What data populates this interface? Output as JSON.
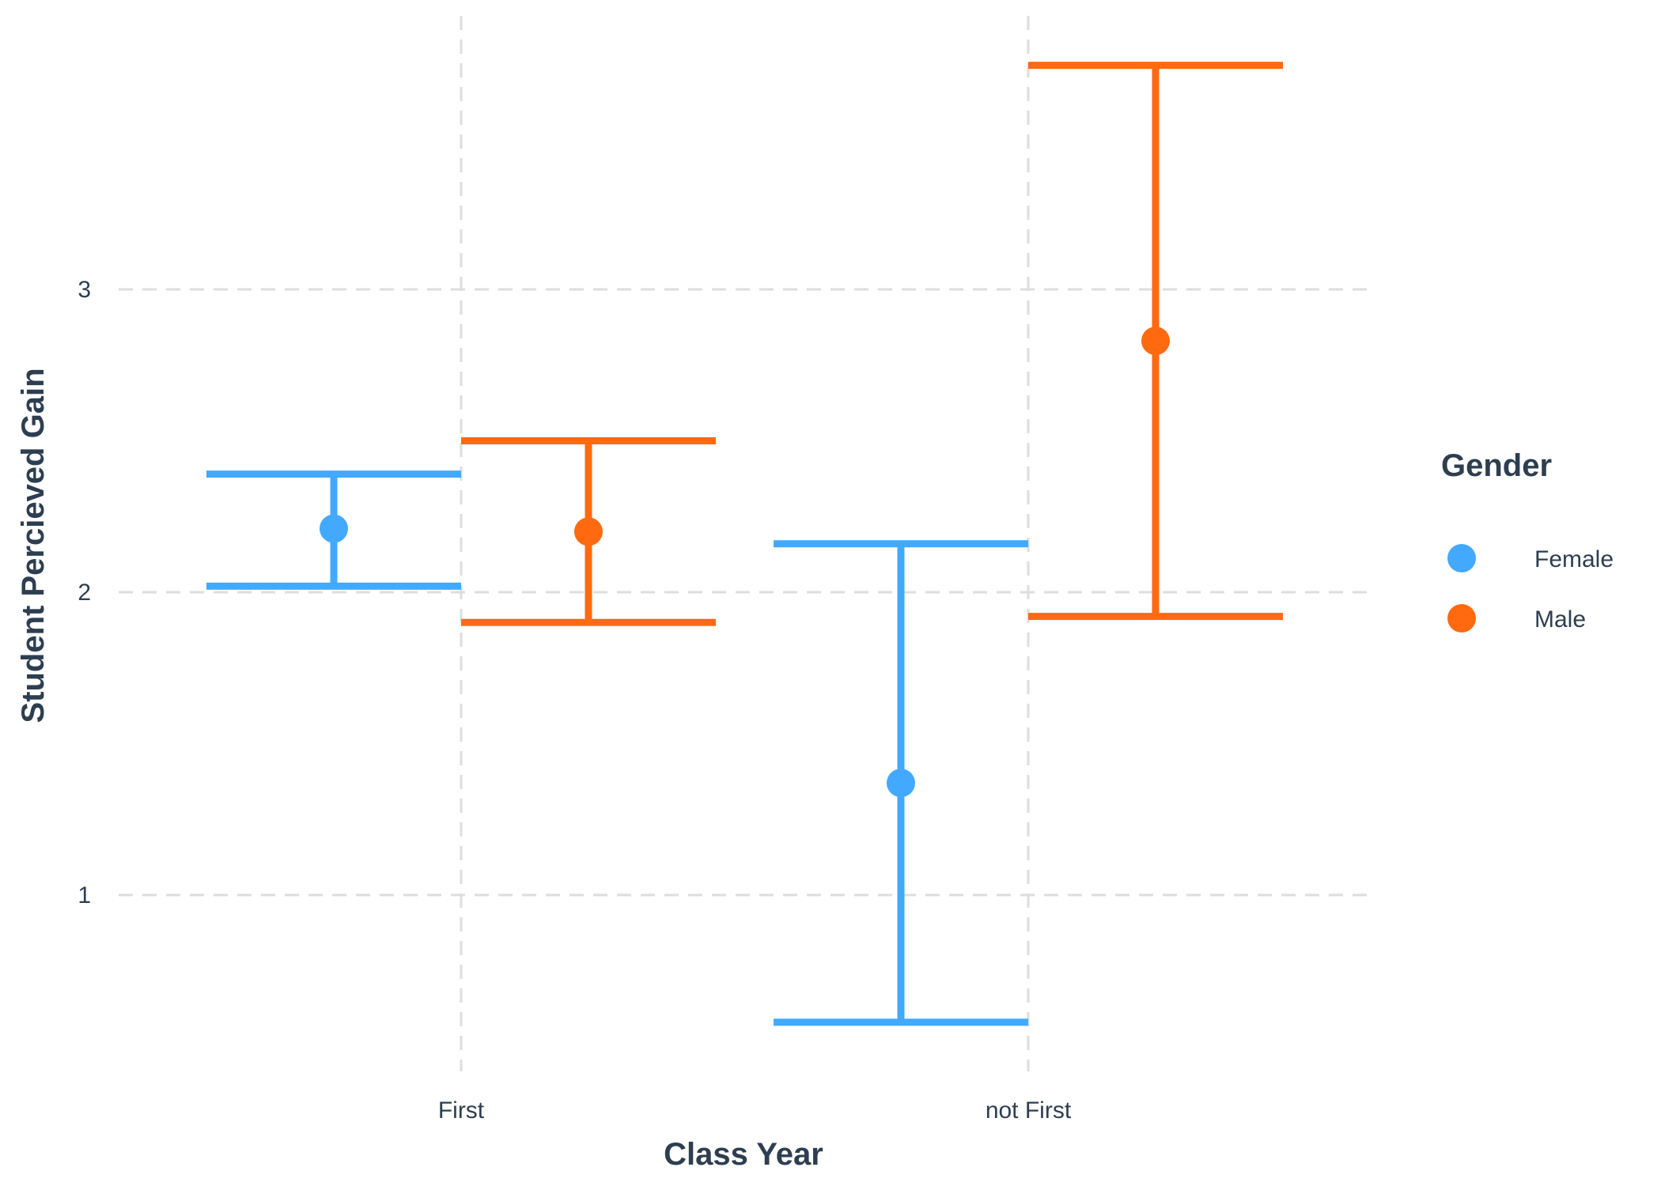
{
  "chart_data": {
    "type": "errorbar",
    "xlabel": "Class Year",
    "ylabel": "Student Percieved Gain",
    "categories": [
      "First",
      "not First"
    ],
    "ylim": [
      0.45,
      3.95
    ],
    "yticks": [
      1,
      2,
      3
    ],
    "grid": true,
    "legend": {
      "title": "Gender",
      "position": "right"
    },
    "series": [
      {
        "name": "Female",
        "color": "#42a9ff",
        "points": [
          {
            "category": "First",
            "mean": 2.21,
            "lower": 2.02,
            "upper": 2.39
          },
          {
            "category": "not First",
            "mean": 1.37,
            "lower": 0.58,
            "upper": 2.16
          }
        ]
      },
      {
        "name": "Male",
        "color": "#ff6a10",
        "points": [
          {
            "category": "First",
            "mean": 2.2,
            "lower": 1.9,
            "upper": 2.5
          },
          {
            "category": "not First",
            "mean": 2.83,
            "lower": 1.92,
            "upper": 3.74
          }
        ]
      }
    ]
  }
}
